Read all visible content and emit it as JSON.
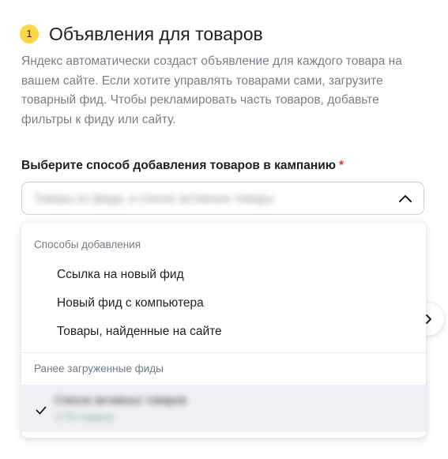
{
  "section": {
    "step_number": "1",
    "title": "Объявления для товаров",
    "description": "Яндекс автоматически создаст объявление для каждого товара на вашем сайте. Если хотите управлять товарами сами, загрузите товарный фид. Чтобы рекламировать часть товаров, добавьте фильтры к фиду или сайту."
  },
  "field": {
    "label": "Выберите способ добавления товаров в кампанию",
    "required_mark": "*",
    "selected_value": "Товары из фида, в списке активные товары"
  },
  "dropdown": {
    "groups": [
      {
        "header": "Способы добавления",
        "options": [
          {
            "label": "Ссылка на новый фид"
          },
          {
            "label": "Новый фид с компьютера"
          },
          {
            "label": "Товары, найденные на сайте"
          }
        ]
      },
      {
        "header": "Ранее загруженные фиды",
        "feeds": [
          {
            "name": "Список активных товаров",
            "meta": "1776 товаров",
            "selected": true
          }
        ]
      }
    ]
  },
  "colors": {
    "accent_badge": "#fbd649",
    "required": "#e0332b",
    "selected_row": "#eef0f5"
  },
  "icons": {
    "select_chevron": "chevron-up-icon",
    "side_button": "chevron-right-icon",
    "selected_mark": "checkmark-icon"
  }
}
